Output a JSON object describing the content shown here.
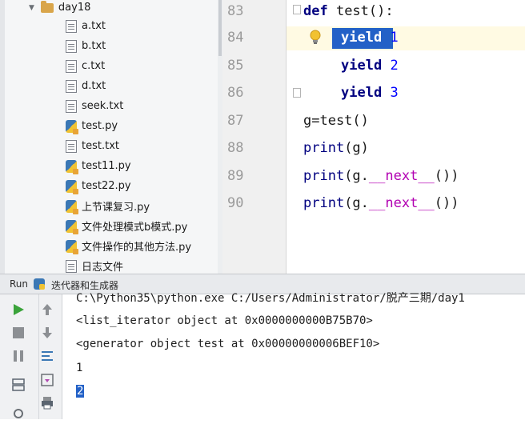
{
  "project_tree": {
    "folder": "day18",
    "items": [
      {
        "name": "a.txt",
        "type": "txt"
      },
      {
        "name": "b.txt",
        "type": "txt"
      },
      {
        "name": "c.txt",
        "type": "txt"
      },
      {
        "name": "d.txt",
        "type": "txt"
      },
      {
        "name": "seek.txt",
        "type": "txt"
      },
      {
        "name": "test.py",
        "type": "py"
      },
      {
        "name": "test.txt",
        "type": "txt"
      },
      {
        "name": "test11.py",
        "type": "py"
      },
      {
        "name": "test22.py",
        "type": "py"
      },
      {
        "name": "上节课复习.py",
        "type": "py"
      },
      {
        "name": "文件处理模式b模式.py",
        "type": "py"
      },
      {
        "name": "文件操作的其他方法.py",
        "type": "py"
      },
      {
        "name": "日志文件",
        "type": "txt"
      }
    ]
  },
  "editor": {
    "line_numbers": [
      "83",
      "84",
      "85",
      "86",
      "87",
      "88",
      "89",
      "90"
    ],
    "lines": {
      "l83": {
        "kw": "def",
        "rest": " test():"
      },
      "l84": {
        "kw": "yield",
        "num": "1"
      },
      "l85": {
        "kw": "yield",
        "num": "2"
      },
      "l86": {
        "kw": "yield",
        "num": "3"
      },
      "l87": {
        "text": "g=test()"
      },
      "l88": {
        "fn": "print",
        "arg": "(g)"
      },
      "l89": {
        "fn": "print",
        "pre": "(g.",
        "dunder": "__next__",
        "post": "())"
      },
      "l90": {
        "fn": "print",
        "pre": "(g.",
        "dunder": "__next__",
        "post": "())"
      }
    }
  },
  "run_panel": {
    "label": "Run",
    "config_name": "迭代器和生成器",
    "output": [
      "C:\\Python35\\python.exe C:/Users/Administrator/脱产三期/day1",
      "<list_iterator object at 0x0000000000B75B70>",
      "<generator object test at 0x00000000006BEF10>",
      "1",
      "2"
    ]
  },
  "colors": {
    "selection": "#2361c7",
    "keyword": "#000080",
    "number": "#0000ff",
    "dunder": "#b200b2",
    "run_green": "#3aa33a"
  },
  "icons": [
    "folder-icon",
    "text-file-icon",
    "python-file-icon",
    "lightbulb-icon",
    "run-icon",
    "stop-icon",
    "pause-icon",
    "rerun-icon",
    "scroll-up-icon",
    "scroll-down-icon",
    "soft-wrap-icon",
    "print-icon"
  ]
}
